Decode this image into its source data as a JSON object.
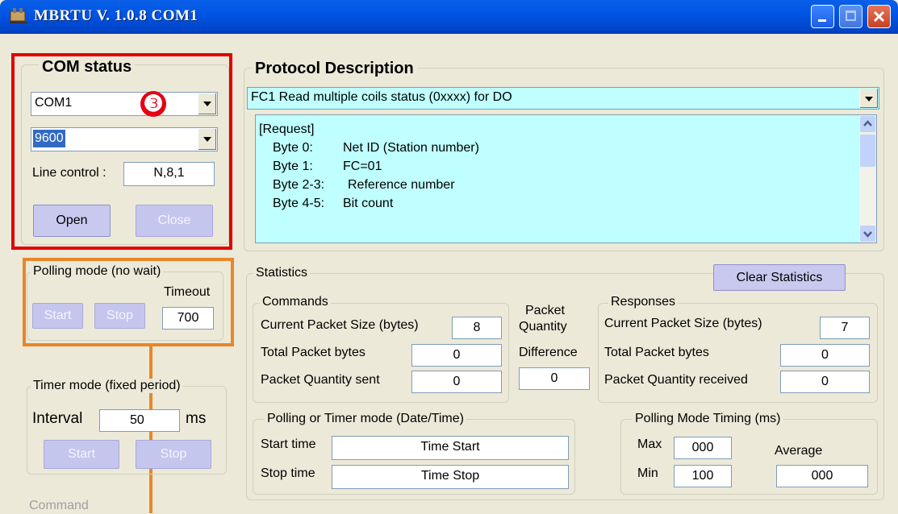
{
  "window": {
    "title": "MBRTU  V. 1.0.8  COM1"
  },
  "com_status": {
    "title": "COM status",
    "port": "COM1",
    "baud": "9600",
    "badge": "❸",
    "line_control_label": "Line control :",
    "line_control_value": "N,8,1",
    "open_label": "Open",
    "close_label": "Close"
  },
  "protocol": {
    "title": "Protocol Description",
    "function_selected": "FC1  Read multiple coils status (0xxxx)  for DO",
    "request_lines": [
      {
        "a": "[Request]",
        "b": ""
      },
      {
        "a": "Byte 0:",
        "b": "Net ID (Station number)"
      },
      {
        "a": "Byte 1:",
        "b": "FC=01"
      },
      {
        "a": "Byte 2-3:",
        "b": "Reference number"
      },
      {
        "a": "Byte 4-5:",
        "b": "Bit count"
      }
    ]
  },
  "polling": {
    "title": "Polling mode (no wait)",
    "timeout_label": "Timeout",
    "timeout_value": "700",
    "start_label": "Start",
    "stop_label": "Stop"
  },
  "timer": {
    "title": "Timer mode (fixed period)",
    "interval_label": "Interval",
    "interval_value": "50",
    "unit": "ms",
    "start_label": "Start",
    "stop_label": "Stop"
  },
  "command": {
    "title": "Command"
  },
  "statistics": {
    "title": "Statistics",
    "clear_label": "Clear Statistics",
    "commands": {
      "title": "Commands",
      "current_size_label": "Current Packet Size (bytes)",
      "current_size_value": "8",
      "total_bytes_label": "Total Packet bytes",
      "total_bytes_value": "0",
      "qty_sent_label": "Packet Quantity sent",
      "qty_sent_value": "0"
    },
    "difference": {
      "label_line1": "Packet",
      "label_line2": "Quantity",
      "label_line3": "Difference",
      "value": "0"
    },
    "responses": {
      "title": "Responses",
      "current_size_label": "Current Packet Size (bytes)",
      "current_size_value": "7",
      "total_bytes_label": "Total Packet bytes",
      "total_bytes_value": "0",
      "qty_received_label": "Packet Quantity received",
      "qty_received_value": "0"
    },
    "datetime": {
      "title": "Polling  or Timer mode  (Date/Time)",
      "start_label": "Start time",
      "start_value": "Time Start",
      "stop_label": "Stop time",
      "stop_value": "Time Stop"
    },
    "timing": {
      "title": "Polling Mode Timing (ms)",
      "max_label": "Max",
      "max_value": "000",
      "min_label": "Min",
      "min_value": "100",
      "avg_label": "Average",
      "avg_value": "000"
    }
  },
  "colors": {
    "highlight_red": "#E00000",
    "highlight_orange": "#E8862A",
    "text_area": "#BFFFFF"
  }
}
